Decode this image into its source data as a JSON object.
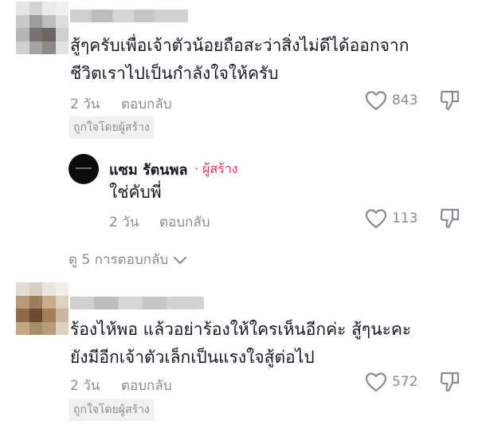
{
  "comments": [
    {
      "text_lines": [
        "สู้ๆครับเพื่อเจ้าตัวน้อยถือสะว่าสิ่งไม่ดีได้ออกจาก",
        "ชีวิตเราไปเป็นกำลังใจให้ครับ"
      ],
      "time": "2 วัน",
      "reply_label": "ตอบกลับ",
      "likes": "843",
      "badge": "ถูกใจโดยผู้สร้าง"
    },
    {
      "text_lines": [
        "ร้องไห้พอ แล้วอย่าร้องให้ใครเห็นอีกค่ะ สู้ๆนะคะ",
        "ยังมีอีกเจ้าตัวเล็กเป็นแรงใจสู้ต่อไป"
      ],
      "time": "2 วัน",
      "reply_label": "ตอบกลับ",
      "likes": "572",
      "badge": "ถูกใจโดยผู้สร้าง"
    }
  ],
  "reply": {
    "name": "แซม รัตนพล",
    "creator_label": "· ผู้สร้าง",
    "text": "ใช่คับพี่",
    "time": "2 วัน",
    "reply_label": "ตอบกลับ",
    "likes": "113"
  },
  "view_more": {
    "label": "ดู 5 การตอบกลับ"
  },
  "colors": {
    "text": "#161823",
    "muted": "#8a8b91",
    "creator": "#fe2c55",
    "badge_bg": "#f1f1f2"
  },
  "icons": {
    "like": "heart-outline-icon",
    "dislike": "thumbs-down-outline-icon",
    "expand": "chevron-down-icon"
  }
}
